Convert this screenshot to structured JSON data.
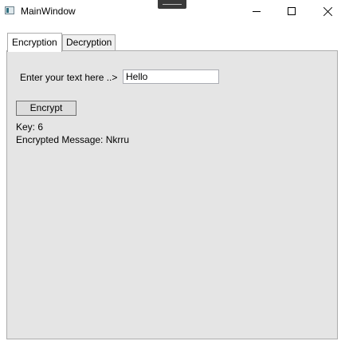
{
  "window": {
    "title": "MainWindow",
    "app_icon": "window-app-icon",
    "controls": [
      "minimize-icon",
      "maximize-icon",
      "close-icon"
    ]
  },
  "tabs": [
    {
      "label": "Encryption",
      "selected": true
    },
    {
      "label": "Decryption",
      "selected": false
    }
  ],
  "encryption": {
    "prompt_label": "Enter your text here ..>",
    "input_value": "Hello",
    "button_label": "Encrypt",
    "key_text": "Key: 6",
    "message_text": "Encrypted Message: Nkrru"
  },
  "colors": {
    "panel_background": "#e5e5e5",
    "border": "#acacac"
  }
}
